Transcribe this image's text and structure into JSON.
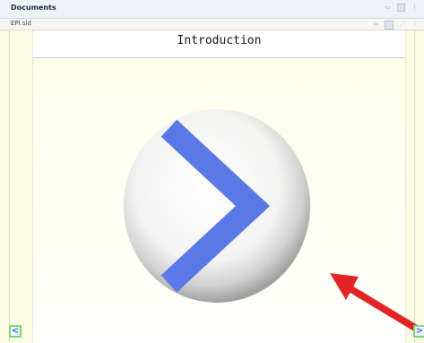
{
  "window": {
    "title": "Documents"
  },
  "tab": {
    "file_name": "EPI.sld"
  },
  "slide": {
    "title": "Introduction"
  },
  "navigation": {
    "prev_icon": "chevron-left-icon",
    "next_icon": "chevron-right-icon"
  },
  "colors": {
    "accent_blue": "#5a79e6",
    "arrow_red": "#e02424",
    "slide_bg": "#fbfbe3"
  }
}
